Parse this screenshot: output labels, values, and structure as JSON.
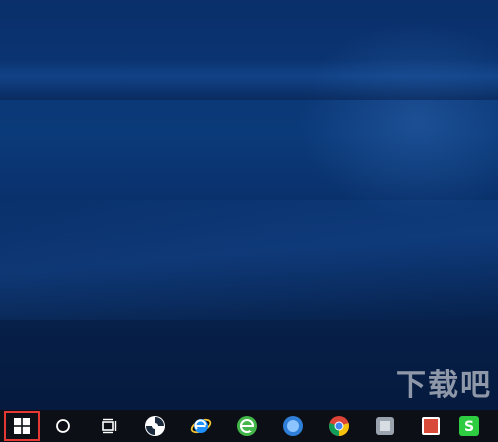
{
  "desktop": {
    "wallpaper": "windows-10-hero-blue",
    "colors": {
      "wallpaper_dark": "#061f47",
      "wallpaper_mid": "#0b3a7a",
      "taskbar": "#0c0f16",
      "start_highlight": "#e53935"
    }
  },
  "taskbar": {
    "items": [
      {
        "id": "start",
        "icon": "windows-start-icon",
        "highlighted": true
      },
      {
        "id": "search",
        "icon": "cortana-search-icon"
      },
      {
        "id": "task-view",
        "icon": "task-view-icon"
      },
      {
        "id": "app1",
        "icon": "pinwheel-app-icon"
      },
      {
        "id": "ie",
        "icon": "internet-explorer-icon"
      },
      {
        "id": "browser-green",
        "icon": "green-e-browser-icon"
      },
      {
        "id": "app-blue",
        "icon": "blue-circle-app-icon"
      },
      {
        "id": "chrome",
        "icon": "chrome-icon"
      },
      {
        "id": "app-gray",
        "icon": "gray-app-icon"
      },
      {
        "id": "app-red",
        "icon": "red-app-icon"
      },
      {
        "id": "sogou",
        "icon": "green-s-app-icon"
      }
    ]
  },
  "watermark": {
    "text": "下载吧"
  }
}
